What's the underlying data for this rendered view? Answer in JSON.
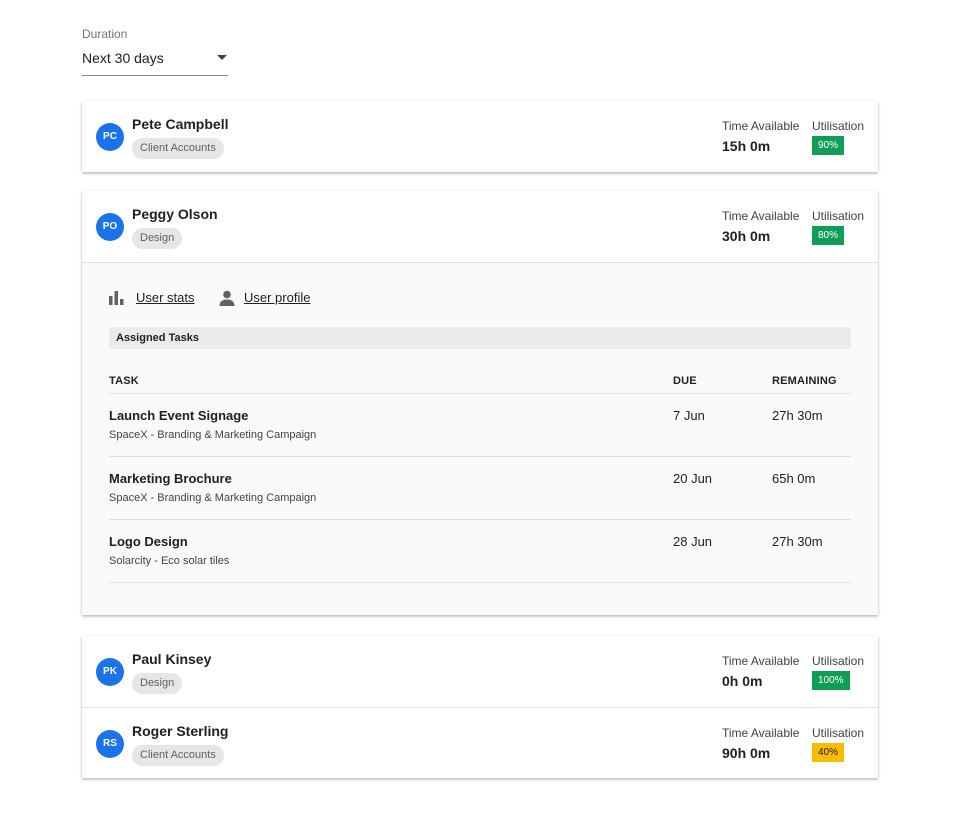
{
  "filter": {
    "label": "Duration",
    "selected": "Next 30 days"
  },
  "labels": {
    "time_available": "Time Available",
    "utilisation": "Utilisation"
  },
  "users": [
    {
      "initials": "PC",
      "name": "Pete Campbell",
      "department": "Client Accounts",
      "time_available": "15h 0m",
      "utilisation": "90%",
      "utilisation_color": "#0f9d58"
    },
    {
      "initials": "PO",
      "name": "Peggy Olson",
      "department": "Design",
      "time_available": "30h 0m",
      "utilisation": "80%",
      "utilisation_color": "#0f9d58"
    },
    {
      "initials": "PK",
      "name": "Paul Kinsey",
      "department": "Design",
      "time_available": "0h 0m",
      "utilisation": "100%",
      "utilisation_color": "#0f9d58"
    },
    {
      "initials": "RS",
      "name": "Roger Sterling",
      "department": "Client Accounts",
      "time_available": "90h 0m",
      "utilisation": "40%",
      "utilisation_color": "#fbbc04"
    }
  ],
  "expanded": {
    "links": {
      "user_stats": "User stats",
      "user_profile": "User profile"
    },
    "icons": {
      "stats": "bar-chart-icon",
      "profile": "person-icon"
    },
    "section_title": "Assigned Tasks",
    "columns": {
      "task": "TASK",
      "due": "DUE",
      "remaining": "REMAINING"
    },
    "tasks": [
      {
        "name": "Launch Event Signage",
        "project": "SpaceX - Branding & Marketing Campaign",
        "due": "7 Jun",
        "remaining": "27h 30m"
      },
      {
        "name": "Marketing Brochure",
        "project": "SpaceX - Branding & Marketing Campaign",
        "due": "20 Jun",
        "remaining": "65h 0m"
      },
      {
        "name": "Logo Design",
        "project": "Solarcity - Eco solar tiles",
        "due": "28 Jun",
        "remaining": "27h 30m"
      }
    ]
  },
  "colors": {
    "avatar": "#1a73e8",
    "badge_green": "#0f9d58",
    "badge_yellow": "#fbbc04"
  }
}
